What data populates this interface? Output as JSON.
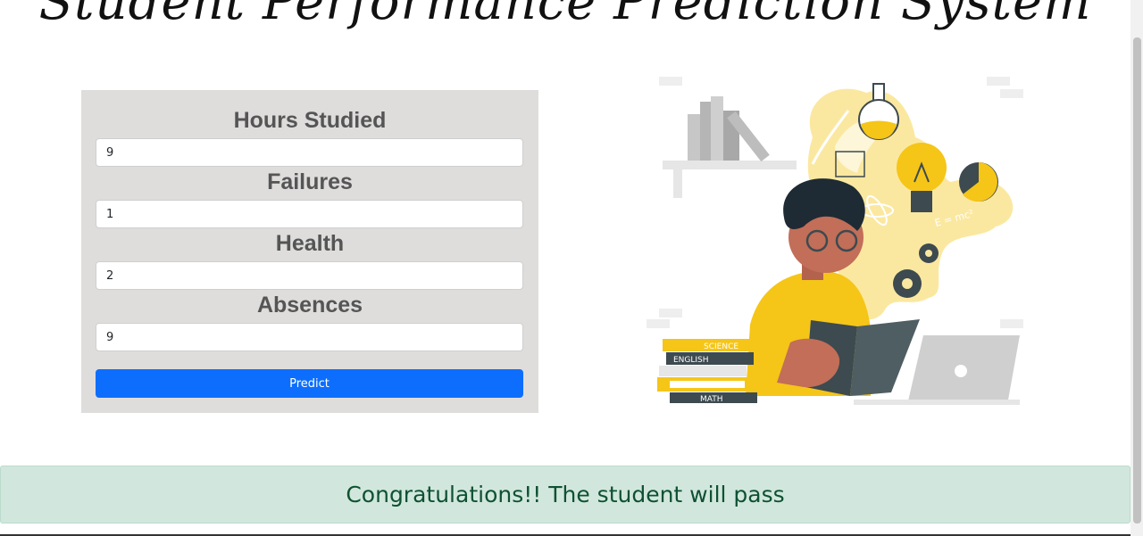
{
  "header": {
    "title": "Student Performance Prediction System"
  },
  "form": {
    "fields": [
      {
        "label": "Hours Studied",
        "value": "9"
      },
      {
        "label": "Failures",
        "value": "1"
      },
      {
        "label": "Health",
        "value": "2"
      },
      {
        "label": "Absences",
        "value": "9"
      }
    ],
    "submit_label": "Predict"
  },
  "illustration": {
    "book_labels": [
      "SCIENCE",
      "ENGLISH",
      "MATH"
    ],
    "formula": "E = mc²"
  },
  "result": {
    "message": "Congratulations!! The student will pass"
  },
  "colors": {
    "primary": "#0d6efd",
    "panel_bg": "#dedddc",
    "alert_bg": "#d1e7dd",
    "alert_text": "#0f5132",
    "accent_yellow": "#f5c518"
  }
}
